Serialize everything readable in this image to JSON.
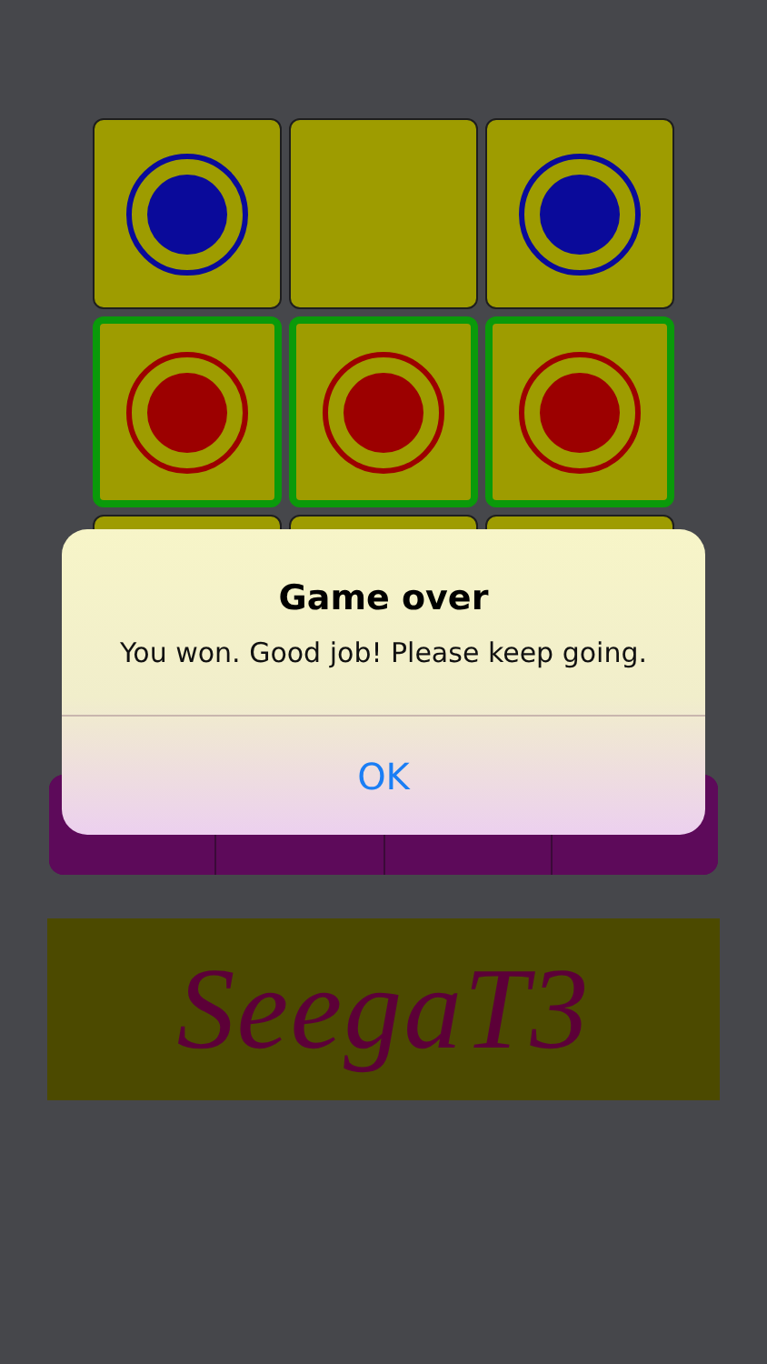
{
  "board": {
    "rows": [
      {
        "cells": [
          {
            "color": "#0a0a9a",
            "highlighted": false
          },
          {
            "highlighted": false
          },
          {
            "color": "#0a0a9a",
            "highlighted": false
          }
        ]
      },
      {
        "cells": [
          {
            "color": "#9c0000",
            "highlighted": true
          },
          {
            "color": "#9c0000",
            "highlighted": true
          },
          {
            "color": "#9c0000",
            "highlighted": true
          }
        ]
      },
      {
        "cells": [
          {
            "highlighted": false
          },
          {
            "highlighted": false
          },
          {
            "highlighted": false
          }
        ]
      }
    ]
  },
  "toolbar": {
    "segments": [
      {
        "kind": "button"
      },
      {
        "kind": "button"
      },
      {
        "kind": "button"
      },
      {
        "kind": "button"
      }
    ]
  },
  "logo": {
    "text": "SeegaT3"
  },
  "alert": {
    "title": "Game over",
    "message": "You won. Good job! Please keep going.",
    "button": "OK"
  }
}
